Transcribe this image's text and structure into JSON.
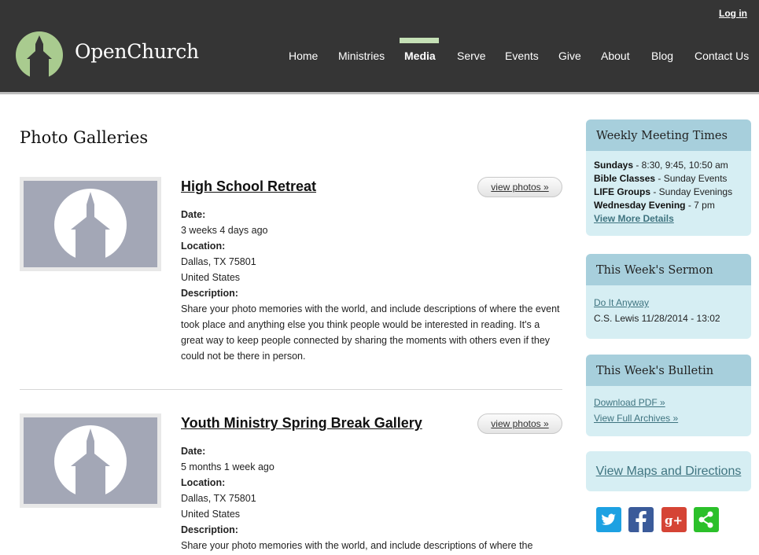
{
  "header": {
    "login": "Log in",
    "brand": "OpenChurch",
    "nav": [
      "Home",
      "Ministries",
      "Media",
      "Serve",
      "Events",
      "Give",
      "About",
      "Blog",
      "Contact Us"
    ],
    "active_nav": "Media"
  },
  "main": {
    "title": "Photo Galleries",
    "view_label": "view photos »",
    "field_labels": {
      "date": "Date:",
      "location": "Location:",
      "description": "Description:"
    },
    "galleries": [
      {
        "title": "High School Retreat",
        "date": "3 weeks 4 days ago",
        "location_line1": "Dallas, TX 75801",
        "location_line2": "United States",
        "description": "Share your photo memories with the world, and include descriptions of where the event took place and anything else you think people would be interested in reading. It's a great way to keep people connected by sharing the moments with others even if they could not be there in person."
      },
      {
        "title": "Youth Ministry Spring Break Gallery",
        "date": "5 months 1 week ago",
        "location_line1": "Dallas, TX 75801",
        "location_line2": "United States",
        "description": "Share your photo memories with the world, and include descriptions of where the"
      }
    ]
  },
  "sidebar": {
    "meeting": {
      "title": "Weekly Meeting Times",
      "rows": [
        {
          "label": "Sundays",
          "value": " - 8:30, 9:45, 10:50 am"
        },
        {
          "label": "Bible Classes",
          "value": " - Sunday Events"
        },
        {
          "label": "LIFE Groups",
          "value": " - Sunday Evenings"
        },
        {
          "label": "Wednesday Evening",
          "value": " - 7 pm"
        }
      ],
      "more": "View More Details"
    },
    "sermon": {
      "title": "This Week's Sermon",
      "link": "Do It Anyway",
      "meta": "C.S. Lewis 11/28/2014 - 13:02"
    },
    "bulletin": {
      "title": "This Week's Bulletin",
      "pdf": "Download PDF »",
      "archives": "View Full Archives »"
    },
    "maps": "View Maps and Directions"
  },
  "colors": {
    "header_bg": "#353535",
    "nav_active": "#c5e0b6",
    "sidebar_box": "#d6eef3",
    "sidebar_head": "#a7cfdc",
    "link": "#3f7480",
    "twitter": "#1da1e2",
    "facebook": "#3b5b9a",
    "google_plus": "#d54435",
    "share": "#2bc02a"
  },
  "social": [
    "twitter-icon",
    "facebook-icon",
    "google-plus-icon",
    "share-icon"
  ]
}
